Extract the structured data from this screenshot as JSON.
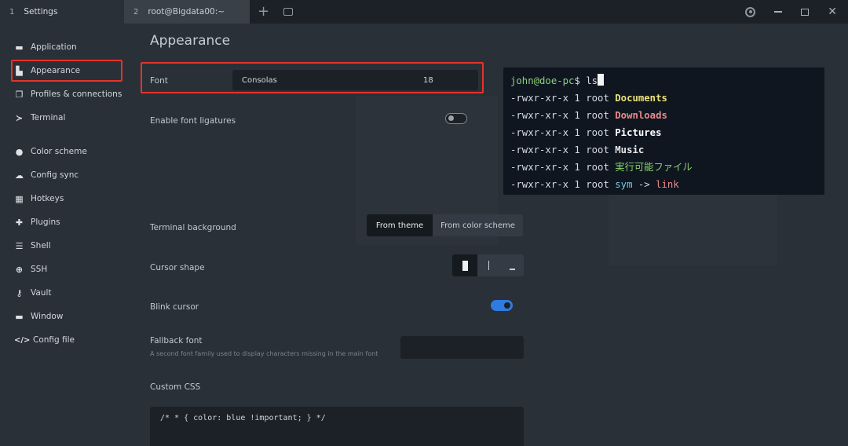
{
  "tabs": [
    {
      "num": "1",
      "label": "Settings"
    },
    {
      "num": "2",
      "label": "root@Bigdata00:~"
    }
  ],
  "sidebar": {
    "items": [
      {
        "icon": "▬",
        "label": "Application"
      },
      {
        "icon": "▙",
        "label": "Appearance"
      },
      {
        "icon": "❐",
        "label": "Profiles & connections"
      },
      {
        "icon": "≻",
        "label": "Terminal"
      },
      {
        "icon": "●",
        "label": "Color scheme"
      },
      {
        "icon": "☁",
        "label": "Config sync"
      },
      {
        "icon": "▦",
        "label": "Hotkeys"
      },
      {
        "icon": "✚",
        "label": "Plugins"
      },
      {
        "icon": "☰",
        "label": "Shell"
      },
      {
        "icon": "⊕",
        "label": "SSH"
      },
      {
        "icon": "⚷",
        "label": "Vault"
      },
      {
        "icon": "▬",
        "label": "Window"
      },
      {
        "icon": "</>",
        "label": "Config file"
      }
    ]
  },
  "main": {
    "title": "Appearance",
    "font": {
      "label": "Font",
      "name": "Consolas",
      "size": "18"
    },
    "ligatures": {
      "label": "Enable font ligatures",
      "enabled": false
    },
    "terminal_background": {
      "label": "Terminal background",
      "options": [
        "From theme",
        "From color scheme"
      ],
      "selected": "From theme"
    },
    "cursor_shape": {
      "label": "Cursor shape",
      "options": [
        "block",
        "beam",
        "underline"
      ],
      "selected": "block"
    },
    "blink_cursor": {
      "label": "Blink cursor",
      "enabled": true
    },
    "fallback_font": {
      "label": "Fallback font",
      "description": "A second font family used to display characters missing in the main font",
      "value": ""
    },
    "custom_css": {
      "label": "Custom CSS",
      "value": "/* * { color: blue !important; } */"
    }
  },
  "terminal_preview": {
    "prompt_user": "john@doe-pc",
    "prompt_symbol": "$",
    "command": " ls",
    "perm": "-rwxr-xr-x 1 root ",
    "entries": [
      "Documents",
      "Downloads",
      "Pictures",
      "Music",
      "実行可能ファイル"
    ],
    "sym": "sym",
    "arrow": " -> ",
    "link": "link"
  },
  "colors": {
    "accent": "#2f7be0",
    "highlight": "#e5342a"
  }
}
